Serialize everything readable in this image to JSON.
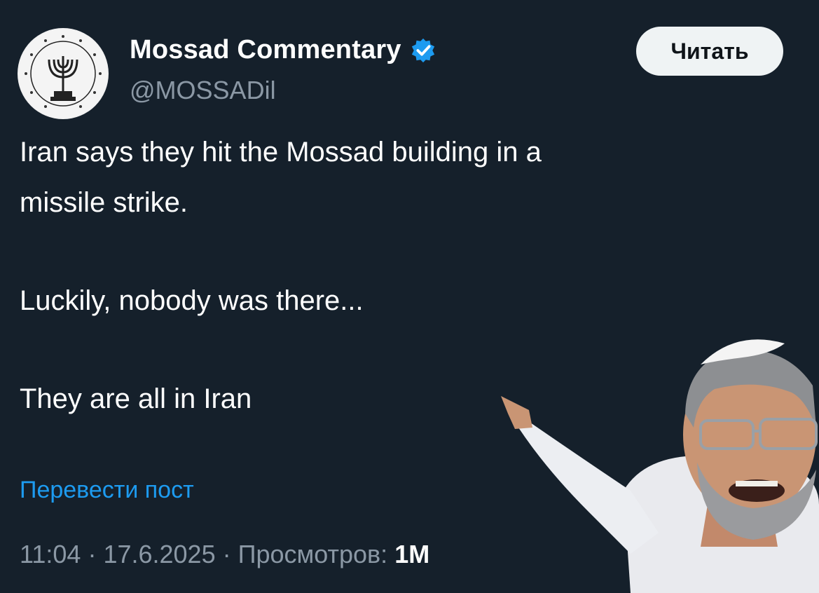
{
  "author": {
    "display_name": "Mossad Commentary",
    "handle": "@MOSSADil",
    "verified_icon": "verified-badge-icon",
    "avatar_icon": "menorah-seal-icon"
  },
  "follow_button": {
    "label": "Читать"
  },
  "tweet": {
    "line1": "Iran says they hit the Mossad building in a",
    "line2": "missile strike.",
    "line3": "Luckily, nobody was there...",
    "line4": "They are all in Iran"
  },
  "translate_link": "Перевести пост",
  "meta": {
    "time": "11:04",
    "date": "17.6.2025",
    "views_label": "Просмотров:",
    "views_count": "1M"
  },
  "colors": {
    "background": "#15202b",
    "accent": "#1d9bf0",
    "muted": "#8b98a5"
  }
}
